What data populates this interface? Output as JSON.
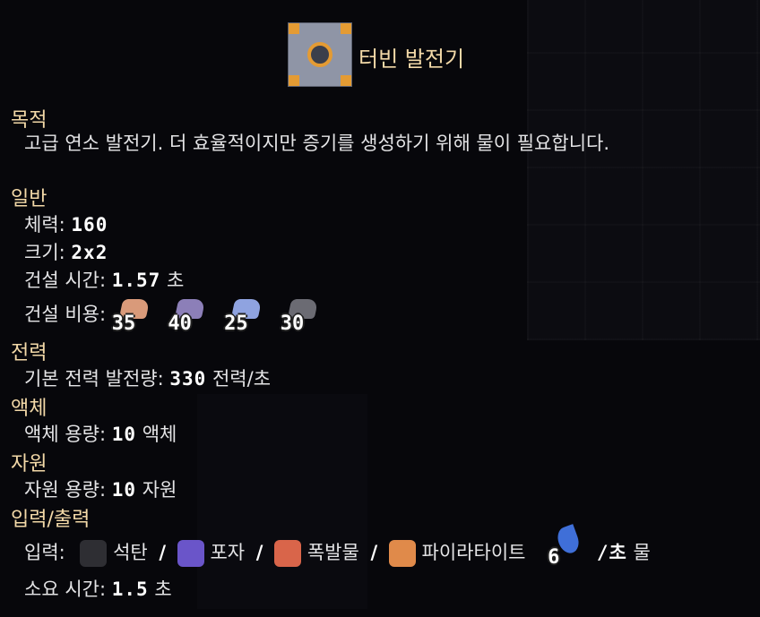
{
  "header": {
    "title": "터빈 발전기",
    "icon": "turbine-generator-block-icon"
  },
  "purpose": {
    "heading": "목적",
    "description": "고급 연소 발전기. 더 효율적이지만 증기를 생성하기 위해 물이 필요합니다."
  },
  "general": {
    "heading": "일반",
    "health_label": "체력:",
    "health_value": "160",
    "size_label": "크기:",
    "size_value": "2x2",
    "build_time_label": "건설 시간:",
    "build_time_value": "1.57",
    "build_time_unit": "초",
    "build_cost_label": "건설 비용:",
    "build_cost": [
      {
        "icon": "copper-icon",
        "color": "#d99a7a",
        "amount": "35"
      },
      {
        "icon": "lead-icon",
        "color": "#8c7fb8",
        "amount": "40"
      },
      {
        "icon": "titanium-icon",
        "color": "#8fa3e0",
        "amount": "25"
      },
      {
        "icon": "silicon-icon",
        "color": "#6b6b73",
        "amount": "30"
      }
    ]
  },
  "power": {
    "heading": "전력",
    "base_output_label": "기본 전력 발전량:",
    "base_output_value": "330",
    "base_output_unit": "전력/초"
  },
  "liquid": {
    "heading": "액체",
    "capacity_label": "액체 용량:",
    "capacity_value": "10",
    "capacity_unit": "액체"
  },
  "resource": {
    "heading": "자원",
    "capacity_label": "자원 용량:",
    "capacity_value": "10",
    "capacity_unit": "자원"
  },
  "io": {
    "heading": "입력/출력",
    "input_label": "입력:",
    "inputs": [
      {
        "icon": "coal-icon",
        "color": "#2e2e33",
        "name": "석탄"
      },
      {
        "icon": "spore-pod-icon",
        "color": "#6a55c9",
        "name": "포자"
      },
      {
        "icon": "blast-compound-icon",
        "color": "#d9654a",
        "name": "폭발물"
      },
      {
        "icon": "pyratite-icon",
        "color": "#e08a4a",
        "name": "파이라타이트"
      }
    ],
    "separator": "/",
    "water_icon": "water-drop-icon",
    "water_amount": "6",
    "water_rate": "/초",
    "water_name": "물",
    "consume_time_label": "소요 시간:",
    "consume_time_value": "1.5",
    "consume_time_unit": "초"
  }
}
